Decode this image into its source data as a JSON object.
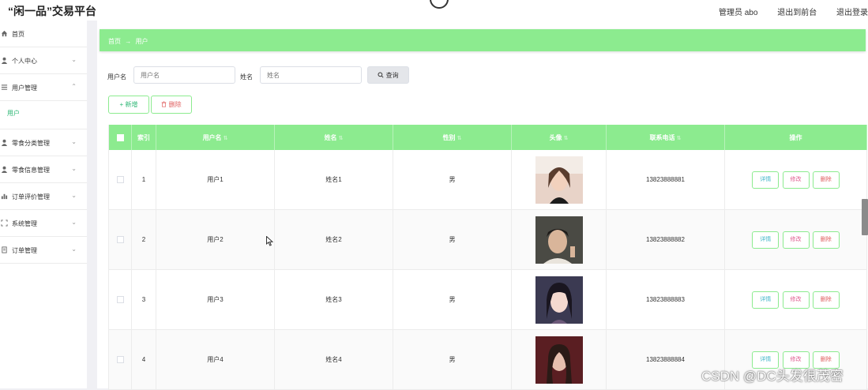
{
  "header": {
    "title": "“闲一品”交易平台",
    "links": [
      "管理员 abo",
      "退出到前台",
      "退出登录"
    ]
  },
  "sidebar": {
    "items": [
      {
        "label": "首页",
        "icon": "home-icon"
      },
      {
        "label": "个人中心",
        "icon": "user-icon"
      },
      {
        "label": "用户管理",
        "icon": "list-icon"
      },
      {
        "label": "零食分类管理",
        "icon": "user-icon"
      },
      {
        "label": "零食信息管理",
        "icon": "user-icon"
      },
      {
        "label": "订单评价管理",
        "icon": "bar-chart-icon"
      },
      {
        "label": "系统管理",
        "icon": "fullscreen-icon"
      },
      {
        "label": "订单管理",
        "icon": "document-icon"
      }
    ],
    "sub_item": "用户"
  },
  "breadcrumb": {
    "home": "首页",
    "separator": "→",
    "current": "用户"
  },
  "search": {
    "username_label": "用户名",
    "username_placeholder": "用户名",
    "name_label": "姓名",
    "name_placeholder": "姓名",
    "query_button": "查询"
  },
  "actions": {
    "add": "新增",
    "delete": "删除"
  },
  "table": {
    "headers": [
      "索引",
      "用户名",
      "姓名",
      "性别",
      "头像",
      "联系电话",
      "操作"
    ],
    "rows": [
      {
        "index": "1",
        "username": "用户1",
        "name": "姓名1",
        "gender": "男",
        "phone": "13823888881"
      },
      {
        "index": "2",
        "username": "用户2",
        "name": "姓名2",
        "gender": "男",
        "phone": "13823888882"
      },
      {
        "index": "3",
        "username": "用户3",
        "name": "姓名3",
        "gender": "男",
        "phone": "13823888883"
      },
      {
        "index": "4",
        "username": "用户4",
        "name": "姓名4",
        "gender": "男",
        "phone": "13823888884"
      }
    ],
    "ops": {
      "detail": "详情",
      "edit": "修改",
      "delete": "删除"
    }
  },
  "watermark": "CSDN @DC头发很茂密",
  "colors": {
    "accent": "#8ceb8f",
    "active": "#2bb673",
    "detail": "#3fb6c8",
    "edit": "#e05c8f",
    "delete": "#e06060"
  }
}
